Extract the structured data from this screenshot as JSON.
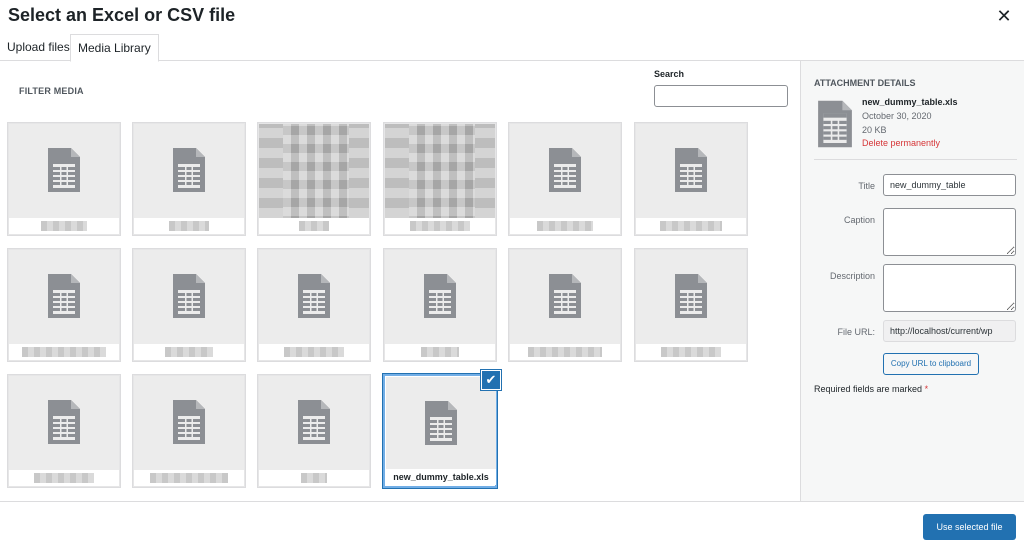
{
  "modal": {
    "title": "Select an Excel or CSV file",
    "close_glyph": "✕"
  },
  "tabs": [
    {
      "label": "Upload files"
    },
    {
      "label": "Media Library",
      "active": true
    }
  ],
  "browser": {
    "filter_label": "FILTER MEDIA",
    "search_label": "Search",
    "search_value": ""
  },
  "tiles": [
    {
      "type": "doc"
    },
    {
      "type": "doc"
    },
    {
      "type": "pixel"
    },
    {
      "type": "pixel"
    },
    {
      "type": "doc"
    },
    {
      "type": "doc"
    },
    {
      "type": "doc"
    },
    {
      "type": "doc"
    },
    {
      "type": "doc"
    },
    {
      "type": "doc"
    },
    {
      "type": "doc"
    },
    {
      "type": "doc"
    },
    {
      "type": "doc"
    },
    {
      "type": "doc"
    },
    {
      "type": "doc"
    },
    {
      "type": "doc",
      "filename": "new_dummy_table.xls",
      "selected": true
    }
  ],
  "details": {
    "heading": "ATTACHMENT DETAILS",
    "filename": "new_dummy_table.xls",
    "date": "October 30, 2020",
    "size": "20 KB",
    "delete_label": "Delete permanently",
    "title_label": "Title",
    "title_value": "new_dummy_table",
    "caption_label": "Caption",
    "description_label": "Description",
    "url_label": "File URL:",
    "url_value": "http://localhost/current/wp",
    "copy_label": "Copy URL to clipboard",
    "required_text": "Required fields are marked",
    "required_star": "*"
  },
  "toolbar": {
    "use_label": "Use selected file"
  },
  "colors": {
    "accent": "#2271b1",
    "danger": "#d63638",
    "selected_border": "#72aee6"
  }
}
